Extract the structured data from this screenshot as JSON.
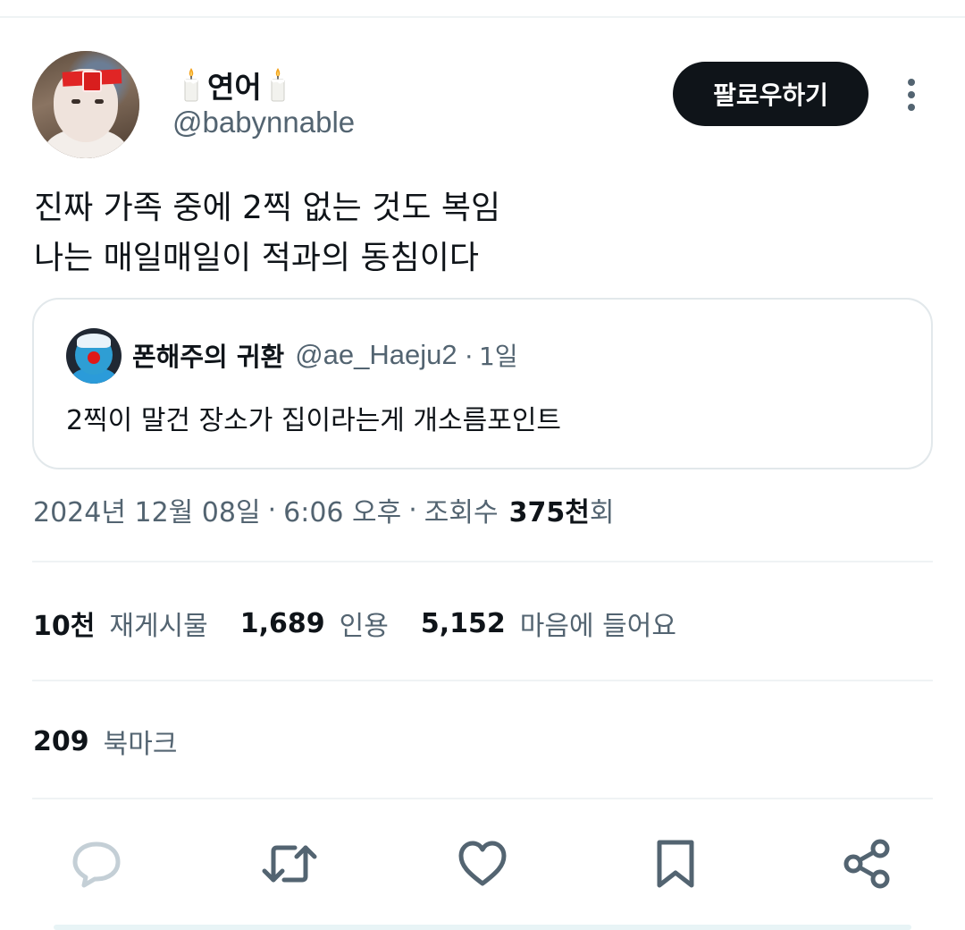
{
  "author": {
    "display_name": "연어",
    "handle": "@babynnable",
    "name_icons": [
      "candle-icon",
      "candle-icon"
    ]
  },
  "follow_button": {
    "label": "팔로우하기"
  },
  "more_button": {
    "icon": "more-vertical-icon"
  },
  "tweet": {
    "lines": [
      "진짜 가족 중에 2찍 없는 것도 복임",
      "나는 매일매일이 적과의 동침이다"
    ]
  },
  "quote": {
    "name": "폰해주의 귀환",
    "handle": "@ae_Haeju2",
    "separator": "·",
    "time": "1일",
    "text": "2찍이 말건 장소가 집이라는게 개소름포인트"
  },
  "meta": {
    "date": "2024년 12월 08일",
    "separator": "·",
    "time": "6:06 오후",
    "views_label": "조회수",
    "views_count": "375천",
    "views_suffix": "회"
  },
  "stats": [
    {
      "count": "10천",
      "label": "재게시물"
    },
    {
      "count": "1,689",
      "label": "인용"
    },
    {
      "count": "5,152",
      "label": "마음에 들어요"
    }
  ],
  "bookmarks": {
    "count": "209",
    "label": "북마크"
  },
  "actions": [
    {
      "name": "reply",
      "icon": "comment-icon"
    },
    {
      "name": "repost",
      "icon": "repost-icon"
    },
    {
      "name": "like",
      "icon": "heart-icon"
    },
    {
      "name": "bookmark",
      "icon": "bookmark-icon"
    },
    {
      "name": "share",
      "icon": "share-icon"
    }
  ],
  "colors": {
    "text": "#0f1419",
    "secondary": "#536471",
    "divider": "#eff3f4",
    "icon": "#536471",
    "reply_icon": "#c4cfd6",
    "button_bg": "#0f1419"
  }
}
